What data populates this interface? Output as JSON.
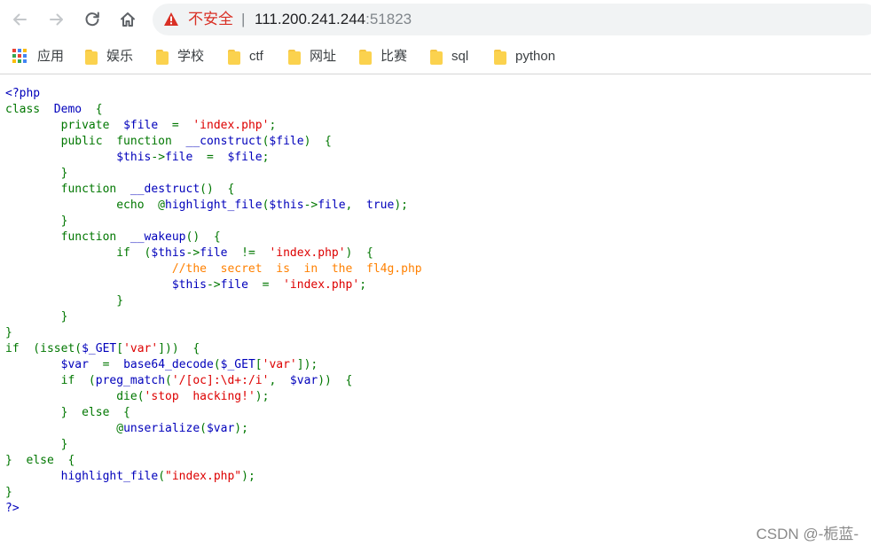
{
  "browser": {
    "security_text": "不安全",
    "separator": "|",
    "url_host": "111.200.241.244",
    "url_port": ":51823"
  },
  "bookmarks": [
    {
      "label": "应用",
      "icon": "apps-grid-icon"
    },
    {
      "label": "娱乐",
      "icon": "folder-icon"
    },
    {
      "label": "学校",
      "icon": "folder-icon"
    },
    {
      "label": "ctf",
      "icon": "folder-icon"
    },
    {
      "label": "网址",
      "icon": "folder-icon"
    },
    {
      "label": "比赛",
      "icon": "folder-icon"
    },
    {
      "label": "sql",
      "icon": "folder-icon"
    },
    {
      "label": "python",
      "icon": "folder-icon"
    }
  ],
  "colors": {
    "keyword": "#007700",
    "default": "#0000bb",
    "string": "#dd0000",
    "comment": "#ff8000",
    "warning": "#d93025"
  },
  "code_lines": [
    [
      [
        "df",
        "<?php"
      ]
    ],
    [
      [
        "kw",
        "class  "
      ],
      [
        "df",
        "Demo  "
      ],
      [
        "kw",
        "{"
      ]
    ],
    [
      [
        "kw",
        "        private  "
      ],
      [
        "df",
        "$file  "
      ],
      [
        "kw",
        "=  "
      ],
      [
        "st",
        "'index.php'"
      ],
      [
        "kw",
        ";"
      ]
    ],
    [
      [
        "kw",
        "        public  function  "
      ],
      [
        "df",
        "__construct"
      ],
      [
        "kw",
        "("
      ],
      [
        "df",
        "$file"
      ],
      [
        "kw",
        ")  {"
      ]
    ],
    [
      [
        "kw",
        "                "
      ],
      [
        "df",
        "$this"
      ],
      [
        "kw",
        "->"
      ],
      [
        "df",
        "file  "
      ],
      [
        "kw",
        "=  "
      ],
      [
        "df",
        "$file"
      ],
      [
        "kw",
        ";"
      ]
    ],
    [
      [
        "kw",
        "        }"
      ]
    ],
    [
      [
        "kw",
        "        function  "
      ],
      [
        "df",
        "__destruct"
      ],
      [
        "kw",
        "()  {"
      ]
    ],
    [
      [
        "kw",
        "                echo  @"
      ],
      [
        "df",
        "highlight_file"
      ],
      [
        "kw",
        "("
      ],
      [
        "df",
        "$this"
      ],
      [
        "kw",
        "->"
      ],
      [
        "df",
        "file"
      ],
      [
        "kw",
        ",  "
      ],
      [
        "df",
        "true"
      ],
      [
        "kw",
        ");"
      ]
    ],
    [
      [
        "kw",
        "        }"
      ]
    ],
    [
      [
        "kw",
        "        function  "
      ],
      [
        "df",
        "__wakeup"
      ],
      [
        "kw",
        "()  {"
      ]
    ],
    [
      [
        "kw",
        "                if  ("
      ],
      [
        "df",
        "$this"
      ],
      [
        "kw",
        "->"
      ],
      [
        "df",
        "file  "
      ],
      [
        "kw",
        "!=  "
      ],
      [
        "st",
        "'index.php'"
      ],
      [
        "kw",
        ")  {"
      ]
    ],
    [
      [
        "kw",
        "                        "
      ],
      [
        "cm",
        "//the  secret  is  in  the  fl4g.php"
      ]
    ],
    [
      [
        "kw",
        "                        "
      ],
      [
        "df",
        "$this"
      ],
      [
        "kw",
        "->"
      ],
      [
        "df",
        "file  "
      ],
      [
        "kw",
        "=  "
      ],
      [
        "st",
        "'index.php'"
      ],
      [
        "kw",
        ";"
      ]
    ],
    [
      [
        "kw",
        "                }"
      ]
    ],
    [
      [
        "kw",
        "        }"
      ]
    ],
    [
      [
        "kw",
        "}"
      ]
    ],
    [
      [
        "kw",
        "if  (isset("
      ],
      [
        "df",
        "$_GET"
      ],
      [
        "kw",
        "["
      ],
      [
        "st",
        "'var'"
      ],
      [
        "kw",
        "]))  {"
      ]
    ],
    [
      [
        "kw",
        "        "
      ],
      [
        "df",
        "$var  "
      ],
      [
        "kw",
        "=  "
      ],
      [
        "df",
        "base64_decode"
      ],
      [
        "kw",
        "("
      ],
      [
        "df",
        "$_GET"
      ],
      [
        "kw",
        "["
      ],
      [
        "st",
        "'var'"
      ],
      [
        "kw",
        "]);"
      ]
    ],
    [
      [
        "kw",
        "        if  ("
      ],
      [
        "df",
        "preg_match"
      ],
      [
        "kw",
        "("
      ],
      [
        "st",
        "'/[oc]:\\d+:/i'"
      ],
      [
        "kw",
        ",  "
      ],
      [
        "df",
        "$var"
      ],
      [
        "kw",
        "))  {"
      ]
    ],
    [
      [
        "kw",
        "                die("
      ],
      [
        "st",
        "'stop  hacking!'"
      ],
      [
        "kw",
        ");"
      ]
    ],
    [
      [
        "kw",
        "        }  else  {"
      ]
    ],
    [
      [
        "kw",
        "                @"
      ],
      [
        "df",
        "unserialize"
      ],
      [
        "kw",
        "("
      ],
      [
        "df",
        "$var"
      ],
      [
        "kw",
        ");"
      ]
    ],
    [
      [
        "kw",
        "        }"
      ]
    ],
    [
      [
        "kw",
        "}  else  {"
      ]
    ],
    [
      [
        "kw",
        "        "
      ],
      [
        "df",
        "highlight_file"
      ],
      [
        "kw",
        "("
      ],
      [
        "st",
        "\"index.php\""
      ],
      [
        "kw",
        ");"
      ]
    ],
    [
      [
        "kw",
        "}"
      ]
    ],
    [
      [
        "df",
        "?>"
      ]
    ]
  ],
  "watermark": "CSDN @-栀蓝-"
}
